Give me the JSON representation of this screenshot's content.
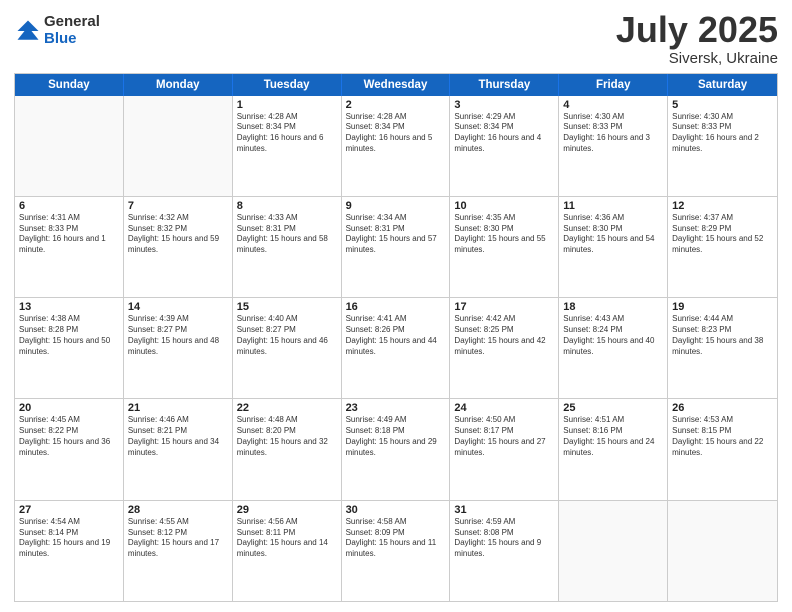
{
  "logo": {
    "general": "General",
    "blue": "Blue"
  },
  "title": {
    "month_year": "July 2025",
    "location": "Siversk, Ukraine"
  },
  "days_of_week": [
    "Sunday",
    "Monday",
    "Tuesday",
    "Wednesday",
    "Thursday",
    "Friday",
    "Saturday"
  ],
  "weeks": [
    [
      {
        "day": "",
        "empty": true
      },
      {
        "day": "",
        "empty": true
      },
      {
        "day": "1",
        "sunrise": "Sunrise: 4:28 AM",
        "sunset": "Sunset: 8:34 PM",
        "daylight": "Daylight: 16 hours and 6 minutes."
      },
      {
        "day": "2",
        "sunrise": "Sunrise: 4:28 AM",
        "sunset": "Sunset: 8:34 PM",
        "daylight": "Daylight: 16 hours and 5 minutes."
      },
      {
        "day": "3",
        "sunrise": "Sunrise: 4:29 AM",
        "sunset": "Sunset: 8:34 PM",
        "daylight": "Daylight: 16 hours and 4 minutes."
      },
      {
        "day": "4",
        "sunrise": "Sunrise: 4:30 AM",
        "sunset": "Sunset: 8:33 PM",
        "daylight": "Daylight: 16 hours and 3 minutes."
      },
      {
        "day": "5",
        "sunrise": "Sunrise: 4:30 AM",
        "sunset": "Sunset: 8:33 PM",
        "daylight": "Daylight: 16 hours and 2 minutes."
      }
    ],
    [
      {
        "day": "6",
        "sunrise": "Sunrise: 4:31 AM",
        "sunset": "Sunset: 8:33 PM",
        "daylight": "Daylight: 16 hours and 1 minute."
      },
      {
        "day": "7",
        "sunrise": "Sunrise: 4:32 AM",
        "sunset": "Sunset: 8:32 PM",
        "daylight": "Daylight: 15 hours and 59 minutes."
      },
      {
        "day": "8",
        "sunrise": "Sunrise: 4:33 AM",
        "sunset": "Sunset: 8:31 PM",
        "daylight": "Daylight: 15 hours and 58 minutes."
      },
      {
        "day": "9",
        "sunrise": "Sunrise: 4:34 AM",
        "sunset": "Sunset: 8:31 PM",
        "daylight": "Daylight: 15 hours and 57 minutes."
      },
      {
        "day": "10",
        "sunrise": "Sunrise: 4:35 AM",
        "sunset": "Sunset: 8:30 PM",
        "daylight": "Daylight: 15 hours and 55 minutes."
      },
      {
        "day": "11",
        "sunrise": "Sunrise: 4:36 AM",
        "sunset": "Sunset: 8:30 PM",
        "daylight": "Daylight: 15 hours and 54 minutes."
      },
      {
        "day": "12",
        "sunrise": "Sunrise: 4:37 AM",
        "sunset": "Sunset: 8:29 PM",
        "daylight": "Daylight: 15 hours and 52 minutes."
      }
    ],
    [
      {
        "day": "13",
        "sunrise": "Sunrise: 4:38 AM",
        "sunset": "Sunset: 8:28 PM",
        "daylight": "Daylight: 15 hours and 50 minutes."
      },
      {
        "day": "14",
        "sunrise": "Sunrise: 4:39 AM",
        "sunset": "Sunset: 8:27 PM",
        "daylight": "Daylight: 15 hours and 48 minutes."
      },
      {
        "day": "15",
        "sunrise": "Sunrise: 4:40 AM",
        "sunset": "Sunset: 8:27 PM",
        "daylight": "Daylight: 15 hours and 46 minutes."
      },
      {
        "day": "16",
        "sunrise": "Sunrise: 4:41 AM",
        "sunset": "Sunset: 8:26 PM",
        "daylight": "Daylight: 15 hours and 44 minutes."
      },
      {
        "day": "17",
        "sunrise": "Sunrise: 4:42 AM",
        "sunset": "Sunset: 8:25 PM",
        "daylight": "Daylight: 15 hours and 42 minutes."
      },
      {
        "day": "18",
        "sunrise": "Sunrise: 4:43 AM",
        "sunset": "Sunset: 8:24 PM",
        "daylight": "Daylight: 15 hours and 40 minutes."
      },
      {
        "day": "19",
        "sunrise": "Sunrise: 4:44 AM",
        "sunset": "Sunset: 8:23 PM",
        "daylight": "Daylight: 15 hours and 38 minutes."
      }
    ],
    [
      {
        "day": "20",
        "sunrise": "Sunrise: 4:45 AM",
        "sunset": "Sunset: 8:22 PM",
        "daylight": "Daylight: 15 hours and 36 minutes."
      },
      {
        "day": "21",
        "sunrise": "Sunrise: 4:46 AM",
        "sunset": "Sunset: 8:21 PM",
        "daylight": "Daylight: 15 hours and 34 minutes."
      },
      {
        "day": "22",
        "sunrise": "Sunrise: 4:48 AM",
        "sunset": "Sunset: 8:20 PM",
        "daylight": "Daylight: 15 hours and 32 minutes."
      },
      {
        "day": "23",
        "sunrise": "Sunrise: 4:49 AM",
        "sunset": "Sunset: 8:18 PM",
        "daylight": "Daylight: 15 hours and 29 minutes."
      },
      {
        "day": "24",
        "sunrise": "Sunrise: 4:50 AM",
        "sunset": "Sunset: 8:17 PM",
        "daylight": "Daylight: 15 hours and 27 minutes."
      },
      {
        "day": "25",
        "sunrise": "Sunrise: 4:51 AM",
        "sunset": "Sunset: 8:16 PM",
        "daylight": "Daylight: 15 hours and 24 minutes."
      },
      {
        "day": "26",
        "sunrise": "Sunrise: 4:53 AM",
        "sunset": "Sunset: 8:15 PM",
        "daylight": "Daylight: 15 hours and 22 minutes."
      }
    ],
    [
      {
        "day": "27",
        "sunrise": "Sunrise: 4:54 AM",
        "sunset": "Sunset: 8:14 PM",
        "daylight": "Daylight: 15 hours and 19 minutes."
      },
      {
        "day": "28",
        "sunrise": "Sunrise: 4:55 AM",
        "sunset": "Sunset: 8:12 PM",
        "daylight": "Daylight: 15 hours and 17 minutes."
      },
      {
        "day": "29",
        "sunrise": "Sunrise: 4:56 AM",
        "sunset": "Sunset: 8:11 PM",
        "daylight": "Daylight: 15 hours and 14 minutes."
      },
      {
        "day": "30",
        "sunrise": "Sunrise: 4:58 AM",
        "sunset": "Sunset: 8:09 PM",
        "daylight": "Daylight: 15 hours and 11 minutes."
      },
      {
        "day": "31",
        "sunrise": "Sunrise: 4:59 AM",
        "sunset": "Sunset: 8:08 PM",
        "daylight": "Daylight: 15 hours and 9 minutes."
      },
      {
        "day": "",
        "empty": true
      },
      {
        "day": "",
        "empty": true
      }
    ]
  ]
}
